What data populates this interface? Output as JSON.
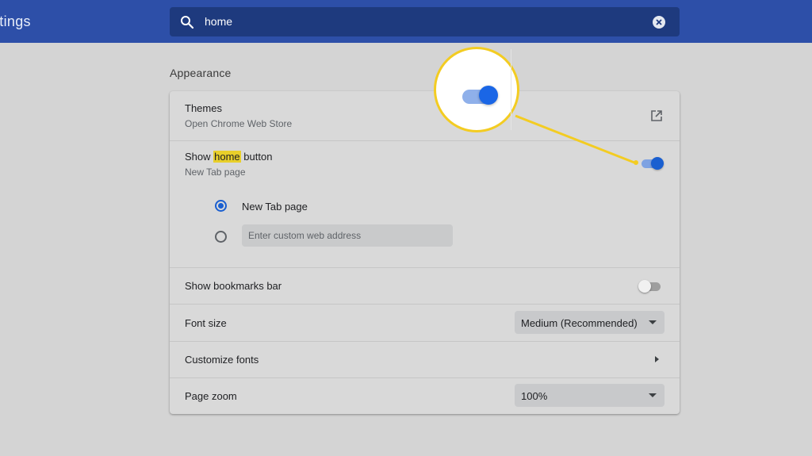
{
  "header": {
    "app_title": "ttings",
    "search": {
      "value": "home",
      "icon": "search-icon",
      "clear_icon": "clear-search-icon"
    }
  },
  "section": {
    "title": "Appearance"
  },
  "settings": {
    "themes": {
      "label": "Themes",
      "sublabel": "Open Chrome Web Store",
      "icon": "external-link-icon"
    },
    "home_button": {
      "label_before": "Show ",
      "label_highlight": "home",
      "label_after": " button",
      "sublabel": "New Tab page",
      "enabled": true,
      "options": [
        {
          "label": "New Tab page",
          "selected": true
        },
        {
          "placeholder": "Enter custom web address",
          "selected": false
        }
      ]
    },
    "bookmarks_bar": {
      "label": "Show bookmarks bar",
      "enabled": false
    },
    "font_size": {
      "label": "Font size",
      "value": "Medium (Recommended)"
    },
    "customize_fonts": {
      "label": "Customize fonts"
    },
    "page_zoom": {
      "label": "Page zoom",
      "value": "100%"
    }
  },
  "colors": {
    "header_bg": "#2d4fa8",
    "search_bg": "#1e3a7e",
    "accent_blue": "#1a5fd0",
    "highlight": "#e8cf2a",
    "callout": "#f3cc22"
  }
}
